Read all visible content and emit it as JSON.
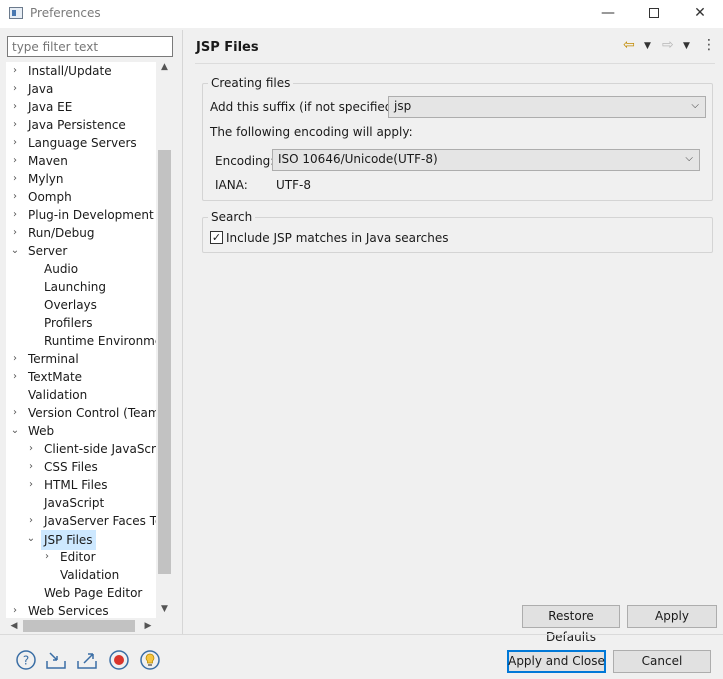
{
  "window": {
    "title": "Preferences",
    "min_glyph": "—",
    "close_glyph": "✕"
  },
  "filter": {
    "placeholder": "type filter text"
  },
  "tree": {
    "rows": [
      {
        "label": "Install/Update",
        "arrow": "›",
        "indent": 0
      },
      {
        "label": "Java",
        "arrow": "›",
        "indent": 0
      },
      {
        "label": "Java EE",
        "arrow": "›",
        "indent": 0
      },
      {
        "label": "Java Persistence",
        "arrow": "›",
        "indent": 0
      },
      {
        "label": "Language Servers",
        "arrow": "›",
        "indent": 0
      },
      {
        "label": "Maven",
        "arrow": "›",
        "indent": 0
      },
      {
        "label": "Mylyn",
        "arrow": "›",
        "indent": 0
      },
      {
        "label": "Oomph",
        "arrow": "›",
        "indent": 0
      },
      {
        "label": "Plug-in Development",
        "arrow": "›",
        "indent": 0
      },
      {
        "label": "Run/Debug",
        "arrow": "›",
        "indent": 0
      },
      {
        "label": "Server",
        "arrow": "⌄",
        "indent": 0
      },
      {
        "label": "Audio",
        "arrow": "",
        "indent": 1
      },
      {
        "label": "Launching",
        "arrow": "",
        "indent": 1
      },
      {
        "label": "Overlays",
        "arrow": "",
        "indent": 1
      },
      {
        "label": "Profilers",
        "arrow": "",
        "indent": 1
      },
      {
        "label": "Runtime Environments",
        "arrow": "",
        "indent": 1
      },
      {
        "label": "Terminal",
        "arrow": "›",
        "indent": 0
      },
      {
        "label": "TextMate",
        "arrow": "›",
        "indent": 0
      },
      {
        "label": "Validation",
        "arrow": "",
        "indent": 0
      },
      {
        "label": "Version Control (Team)",
        "arrow": "›",
        "indent": 0
      },
      {
        "label": "Web",
        "arrow": "⌄",
        "indent": 0
      },
      {
        "label": "Client-side JavaScript",
        "arrow": "›",
        "indent": 1
      },
      {
        "label": "CSS Files",
        "arrow": "›",
        "indent": 1
      },
      {
        "label": "HTML Files",
        "arrow": "›",
        "indent": 1
      },
      {
        "label": "JavaScript",
        "arrow": "",
        "indent": 1
      },
      {
        "label": "JavaServer Faces Tools",
        "arrow": "›",
        "indent": 1
      },
      {
        "label": "JSP Files",
        "arrow": "⌄",
        "indent": 1,
        "selected": true
      },
      {
        "label": "Editor",
        "arrow": "›",
        "indent": 2
      },
      {
        "label": "Validation",
        "arrow": "",
        "indent": 2
      },
      {
        "label": "Web Page Editor",
        "arrow": "",
        "indent": 1
      },
      {
        "label": "Web Services",
        "arrow": "›",
        "indent": 0
      }
    ]
  },
  "page": {
    "title": "JSP Files",
    "creating_files": {
      "group_label": "Creating files",
      "suffix_label": "Add this suffix (if not specified):",
      "suffix_value": "jsp",
      "encoding_note": "The following encoding will apply:",
      "encoding_label": "Encoding:",
      "encoding_value": "ISO 10646/Unicode(UTF-8)",
      "iana_label": "IANA:",
      "iana_value": "UTF-8"
    },
    "search": {
      "group_label": "Search",
      "include_label": "Include JSP matches in Java searches",
      "include_checked": true
    },
    "buttons": {
      "restore_defaults": "Restore Defaults",
      "apply": "Apply"
    }
  },
  "footer": {
    "apply_and_close": "Apply and Close",
    "cancel": "Cancel",
    "icons": [
      "help-icon",
      "import-icon",
      "export-icon",
      "record-icon",
      "lightbulb-icon"
    ]
  }
}
